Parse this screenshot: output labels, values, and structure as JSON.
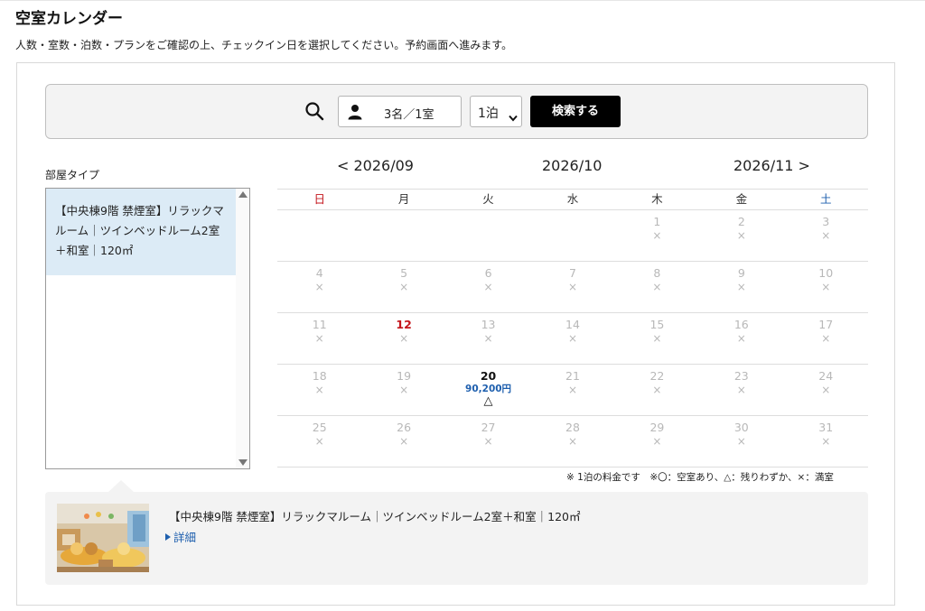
{
  "page": {
    "title": "空室カレンダー",
    "intro": "人数・室数・泊数・プランをご確認の上、チェックイン日を選択してください。予約画面へ進みます。"
  },
  "search": {
    "guests_rooms": "3名／1室",
    "nights": "1泊",
    "submit_label": "検索する",
    "icons": [
      "search-icon",
      "person-icon",
      "chevron-down-icon"
    ]
  },
  "room_type": {
    "label": "部屋タイプ",
    "selected": "【中央棟9階 禁煙室】リラックマルーム｜ツインベッドルーム2室＋和室｜120㎡"
  },
  "calendar": {
    "prev_label": "< 2026/09",
    "current_label": "2026/10",
    "next_label": "2026/11 >",
    "weekdays": [
      "日",
      "月",
      "火",
      "水",
      "木",
      "金",
      "土"
    ],
    "weeks": [
      [
        {
          "d": "",
          "m": ""
        },
        {
          "d": "",
          "m": ""
        },
        {
          "d": "",
          "m": ""
        },
        {
          "d": "",
          "m": ""
        },
        {
          "d": "1",
          "m": "×"
        },
        {
          "d": "2",
          "m": "×"
        },
        {
          "d": "3",
          "m": "×"
        }
      ],
      [
        {
          "d": "4",
          "m": "×"
        },
        {
          "d": "5",
          "m": "×"
        },
        {
          "d": "6",
          "m": "×"
        },
        {
          "d": "7",
          "m": "×"
        },
        {
          "d": "8",
          "m": "×"
        },
        {
          "d": "9",
          "m": "×"
        },
        {
          "d": "10",
          "m": "×"
        }
      ],
      [
        {
          "d": "11",
          "m": "×"
        },
        {
          "d": "12",
          "m": "×",
          "holiday": true
        },
        {
          "d": "13",
          "m": "×"
        },
        {
          "d": "14",
          "m": "×"
        },
        {
          "d": "15",
          "m": "×"
        },
        {
          "d": "16",
          "m": "×"
        },
        {
          "d": "17",
          "m": "×"
        }
      ],
      [
        {
          "d": "18",
          "m": "×"
        },
        {
          "d": "19",
          "m": "×"
        },
        {
          "d": "20",
          "m": "△",
          "price": "90,200円",
          "available": true
        },
        {
          "d": "21",
          "m": "×"
        },
        {
          "d": "22",
          "m": "×"
        },
        {
          "d": "23",
          "m": "×"
        },
        {
          "d": "24",
          "m": "×"
        }
      ],
      [
        {
          "d": "25",
          "m": "×"
        },
        {
          "d": "26",
          "m": "×"
        },
        {
          "d": "27",
          "m": "×"
        },
        {
          "d": "28",
          "m": "×"
        },
        {
          "d": "29",
          "m": "×"
        },
        {
          "d": "30",
          "m": "×"
        },
        {
          "d": "31",
          "m": "×"
        }
      ]
    ],
    "legend": "※ 1泊の料金です　※〇：空室あり、△：残りわずか、×：満室"
  },
  "detail": {
    "room_name": "【中央棟9階 禁煙室】リラックマルーム｜ツインベッドルーム2室＋和室｜120㎡",
    "link_label": "詳細"
  },
  "colors": {
    "sunday": "#c4161c",
    "saturday": "#1e5fae",
    "price": "#1e5fae",
    "selected_room_bg": "#dcebf6",
    "button_bg": "#000000"
  }
}
